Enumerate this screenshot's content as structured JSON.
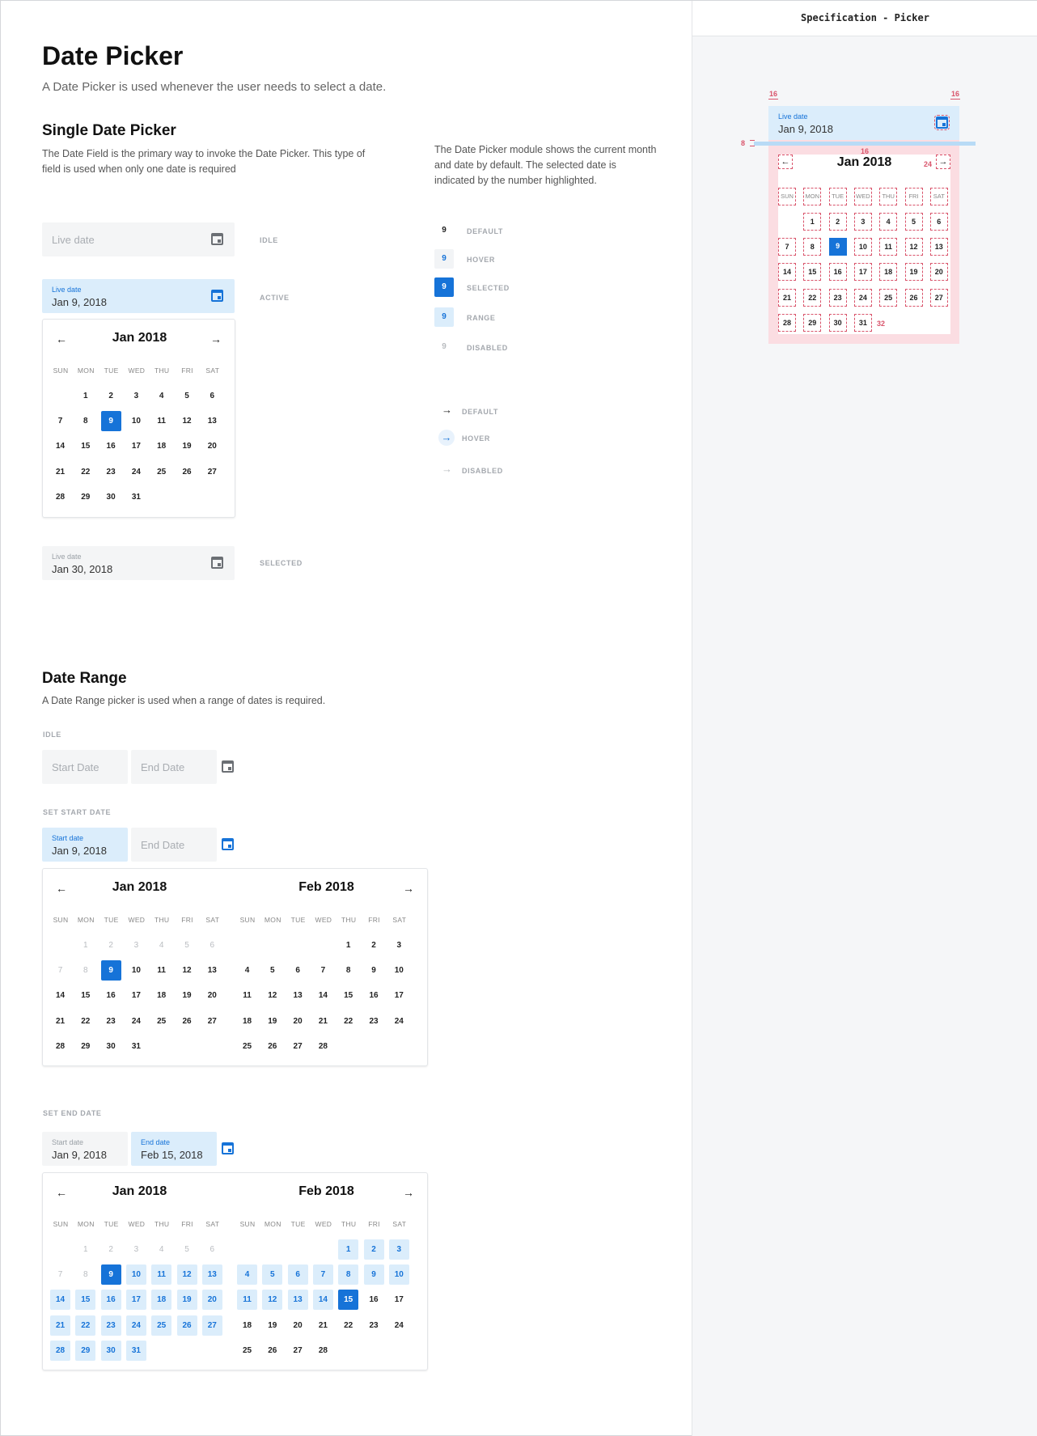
{
  "title": "Date Picker",
  "subtitle": "A Date Picker is used whenever the user needs to select a date.",
  "single": {
    "heading": "Single Date Picker",
    "desc": "The Date Field is the primary way to invoke the Date Picker. This type of field is used when only one date is required",
    "module_desc": "The Date Picker module shows the current month and date by default. The selected date is indicated by the number highlighted.",
    "idle": {
      "placeholder": "Live date",
      "state": "IDLE"
    },
    "active": {
      "label": "Live date",
      "value": "Jan 9, 2018",
      "state": "ACTIVE"
    },
    "selected": {
      "label": "Live date",
      "value": "Jan 30, 2018",
      "state": "SELECTED"
    },
    "month": "Jan 2018"
  },
  "weekdays": [
    "SUN",
    "MON",
    "TUE",
    "WED",
    "THU",
    "FRI",
    "SAT"
  ],
  "day_states": [
    {
      "num": "9",
      "label": "DEFAULT"
    },
    {
      "num": "9",
      "label": "HOVER"
    },
    {
      "num": "9",
      "label": "SELECTED"
    },
    {
      "num": "9",
      "label": "RANGE"
    },
    {
      "num": "9",
      "label": "DISABLED"
    }
  ],
  "arrow_states": [
    {
      "label": "DEFAULT"
    },
    {
      "label": "HOVER"
    },
    {
      "label": "DISABLED"
    }
  ],
  "range": {
    "heading": "Date Range",
    "desc": "A Date Range picker is used when a range of dates is required.",
    "idle": {
      "state": "IDLE",
      "start_ph": "Start Date",
      "end_ph": "End Date"
    },
    "set_start": {
      "state": "SET START DATE",
      "start_label": "Start date",
      "start_value": "Jan 9, 2018",
      "end_ph": "End Date"
    },
    "set_end": {
      "state": "SET END DATE",
      "start_label": "Start date",
      "start_value": "Jan 9, 2018",
      "end_label": "End date",
      "end_value": "Feb 15, 2018"
    },
    "month1": "Jan 2018",
    "month2": "Feb 2018"
  },
  "spec": {
    "header": "Specification - Picker",
    "label": "Live date",
    "value": "Jan 9, 2018",
    "month": "Jan 2018",
    "m16a": "16",
    "m16b": "16",
    "m8": "8",
    "m16c": "16",
    "m24": "24",
    "m32": "32"
  },
  "colors": {
    "accent": "#1673d8",
    "range": "#dbedfb",
    "spec_red": "#d9546b"
  }
}
